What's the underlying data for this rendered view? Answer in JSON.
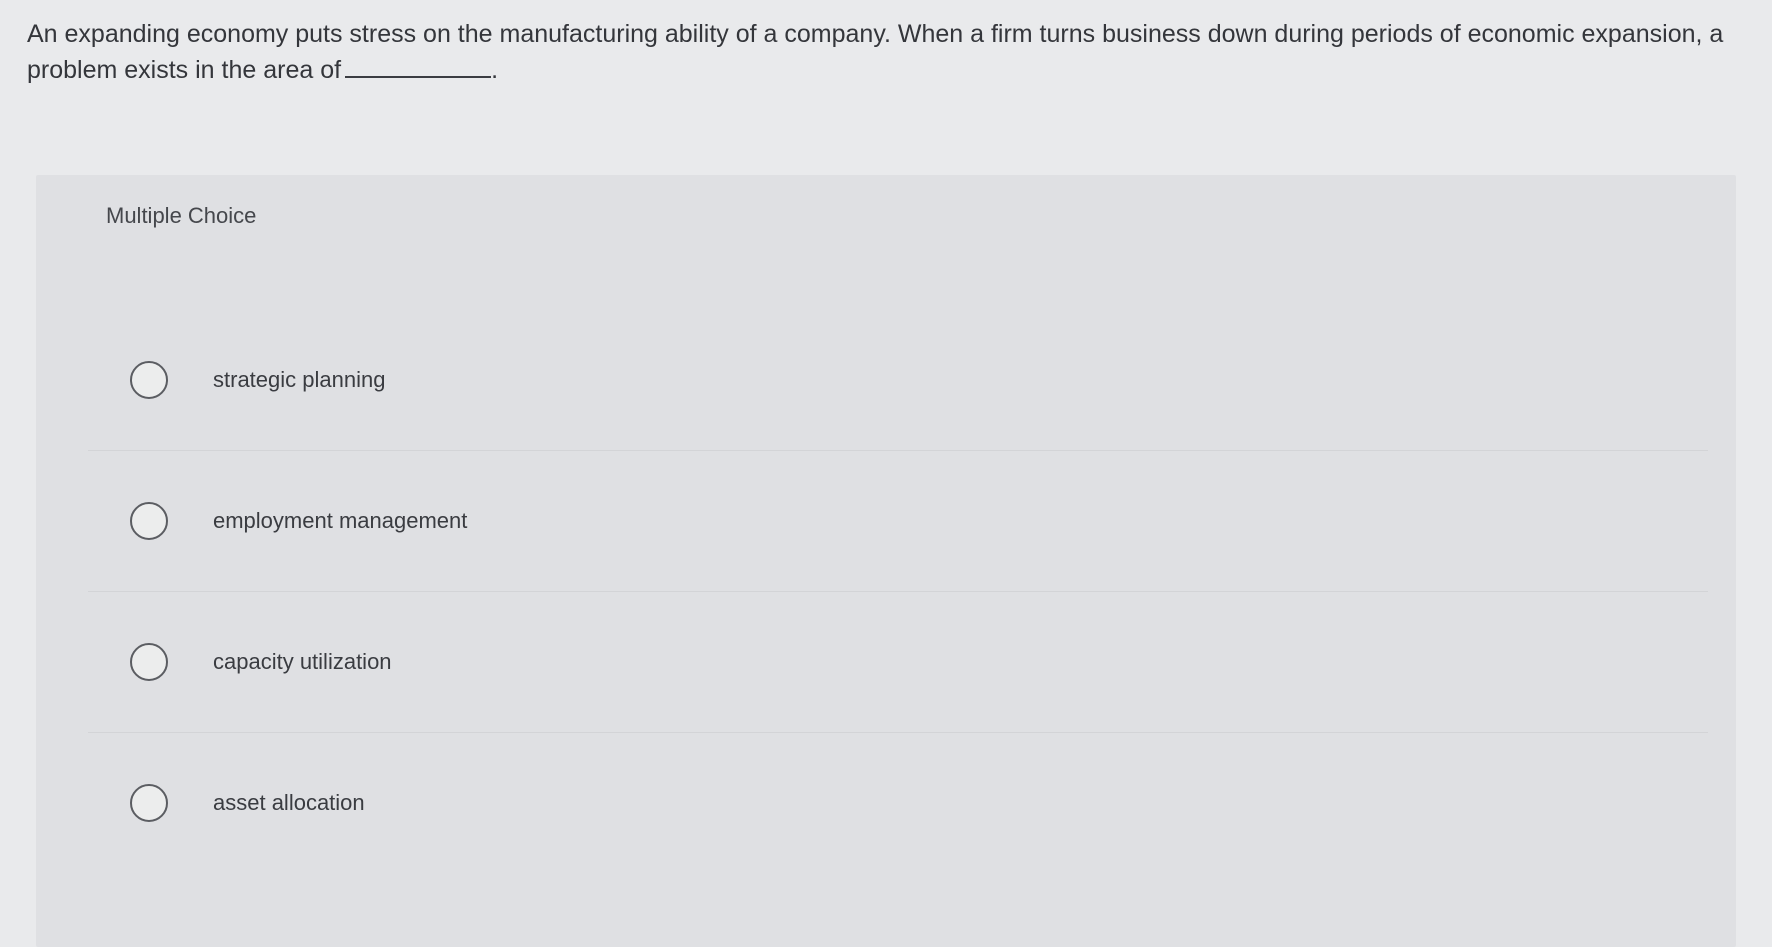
{
  "question": {
    "text_before_blank": "An expanding economy puts stress on the manufacturing ability of a company. When a firm turns business down during periods of economic expansion, a problem exists in the area of",
    "text_after_blank": "."
  },
  "card": {
    "label": "Multiple Choice"
  },
  "choices": [
    {
      "label": "strategic planning",
      "selected": false
    },
    {
      "label": "employment management",
      "selected": false
    },
    {
      "label": "capacity utilization",
      "selected": false
    },
    {
      "label": "asset allocation",
      "selected": false
    }
  ]
}
